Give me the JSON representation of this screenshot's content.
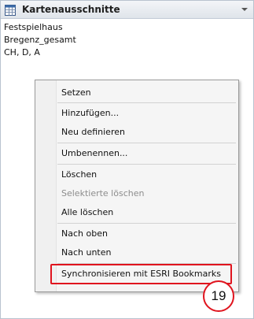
{
  "window": {
    "title": "Kartenausschnitte",
    "icon": "table-grid-icon",
    "dropdown_icon": "chevron-down-icon"
  },
  "list": {
    "items": [
      "Festspielhaus",
      "Bregenz_gesamt",
      "CH, D, A"
    ]
  },
  "context_menu": {
    "items": [
      {
        "label": "Setzen",
        "enabled": true
      },
      {
        "label": "Hinzufügen...",
        "enabled": true
      },
      {
        "label": "Neu definieren",
        "enabled": true
      },
      {
        "label": "Umbenennen...",
        "enabled": true
      },
      {
        "label": "Löschen",
        "enabled": true
      },
      {
        "label": "Selektierte löschen",
        "enabled": false
      },
      {
        "label": "Alle löschen",
        "enabled": true
      },
      {
        "label": "Nach oben",
        "enabled": true
      },
      {
        "label": "Nach unten",
        "enabled": true
      },
      {
        "label": "Synchronisieren mit ESRI Bookmarks",
        "enabled": true,
        "highlighted": true
      }
    ]
  },
  "annotation": {
    "number": "19",
    "color": "#e0141e"
  }
}
